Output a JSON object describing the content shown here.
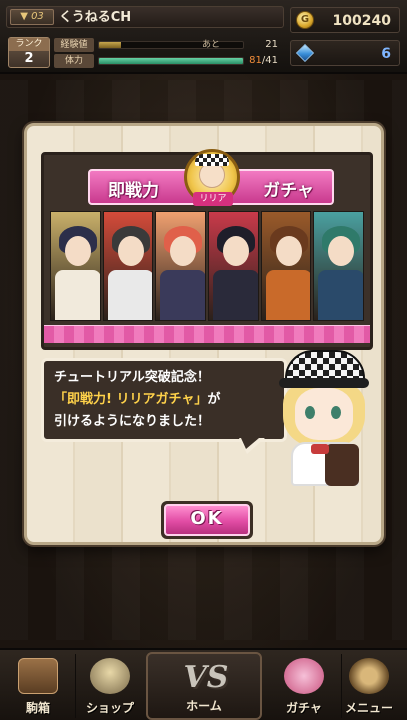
{
  "header": {
    "level": "▼ 03",
    "player_name": "くうねるCH",
    "rank_label": "ランク",
    "rank_value": "2",
    "exp_label": "経験値",
    "exp_remaining_label": "あと",
    "exp_remaining": "21",
    "exp_progress": 0.15,
    "hp_label": "体力",
    "hp_current": "81",
    "hp_max": "/41",
    "hp_progress": 1.0,
    "coins": "100240",
    "gems": "6",
    "coin_icon": "coin-icon",
    "gem_icon": "gem-icon"
  },
  "modal": {
    "banner_title_left": "即戦力",
    "banner_title_right": "ガチャ",
    "medallion_label": "リリア",
    "message_line1": "チュートリアル突破記念！",
    "message_line2_quote": "「即戦力! リリアガチャ」",
    "message_line2_rest": "が",
    "message_line3": "引けるようになりました！",
    "ok_label": "OK"
  },
  "nav": {
    "items": [
      {
        "label": "駒箱",
        "icon": "treasure-chest-icon"
      },
      {
        "label": "ショップ",
        "icon": "shop-icon"
      },
      {
        "label": "ホーム",
        "icon": "vs-home-icon"
      },
      {
        "label": "ガチャ",
        "icon": "gacha-capsule-icon"
      },
      {
        "label": "メニュー",
        "icon": "gear-menu-icon"
      }
    ],
    "vs_text": "VS"
  },
  "colors": {
    "accent_pink": "#e14ca4",
    "highlight_yellow": "#ffd24a",
    "gem_blue": "#7fb6ff"
  },
  "portraits": [
    {
      "hair": "#2c2f4a",
      "bg": "#c9b06a",
      "body": "#f1eadc"
    },
    {
      "hair": "#3a3a3a",
      "bg": "#d44b3a",
      "body": "#e9e9e9"
    },
    {
      "hair": "#e0604a",
      "bg": "#f0a070",
      "body": "#3a3a5a"
    },
    {
      "hair": "#1e1e2a",
      "bg": "#c93a4a",
      "body": "#2a2a3a"
    },
    {
      "hair": "#6a3a1e",
      "bg": "#9a5a2a",
      "body": "#c96a2a"
    },
    {
      "hair": "#2f7a6a",
      "bg": "#4aa0a0",
      "body": "#2a4a6a"
    }
  ]
}
